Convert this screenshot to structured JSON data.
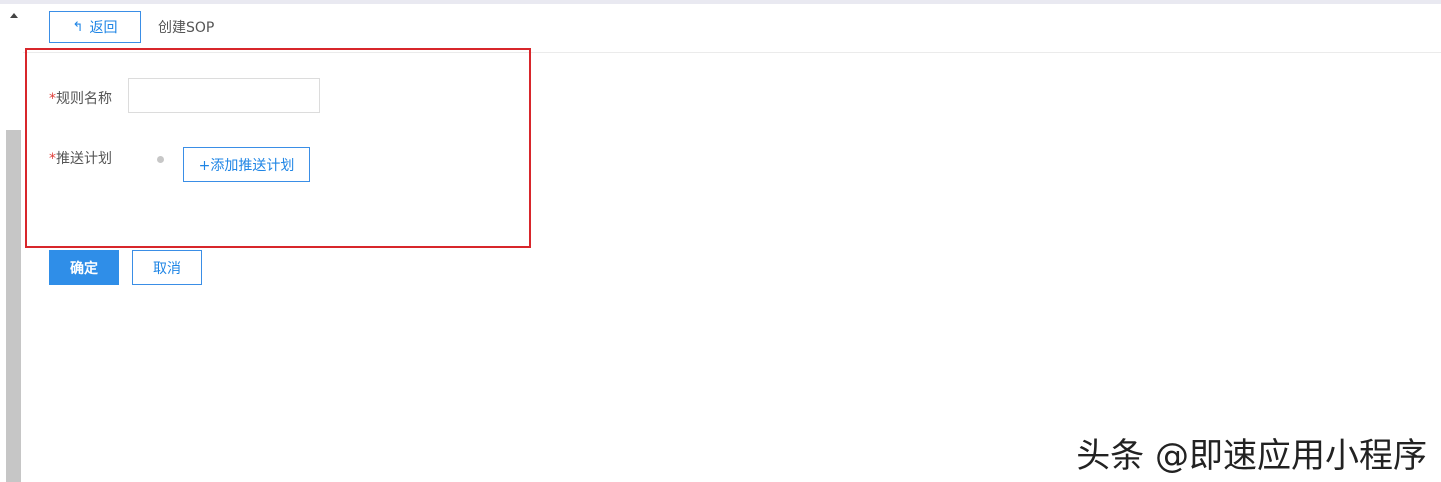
{
  "header": {
    "back_label": "返回",
    "back_icon": "reply-arrow-icon",
    "title": "创建SOP"
  },
  "form": {
    "rule_name": {
      "required_mark": "*",
      "label": "规则名称",
      "value": ""
    },
    "push_plan": {
      "required_mark": "*",
      "label": "推送计划",
      "add_button_label": "+添加推送计划"
    }
  },
  "actions": {
    "confirm_label": "确定",
    "cancel_label": "取消"
  },
  "watermark": {
    "text": "头条 @即速应用小程序"
  },
  "colors": {
    "accent": "#2f8ee8",
    "required": "#e0403b",
    "highlight_border": "#d8262b"
  }
}
